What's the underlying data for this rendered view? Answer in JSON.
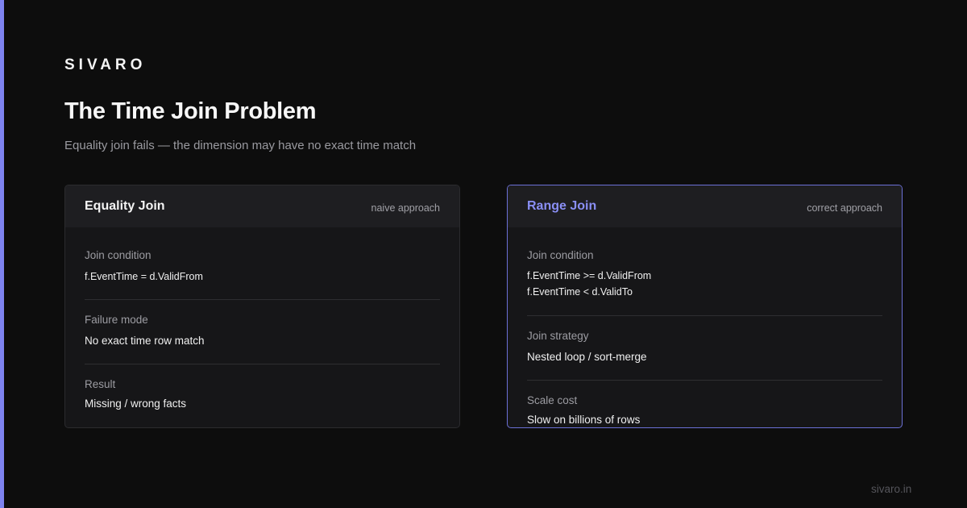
{
  "brand": "SIVARO",
  "title": "The Time Join Problem",
  "subtitle": "Equality join fails — the dimension may have no exact time match",
  "cards": [
    {
      "title": "Equality Join",
      "tag": "naive approach",
      "rows": [
        {
          "label": "Join condition",
          "value_lines": [
            "f.EventTime = d.ValidFrom"
          ]
        },
        {
          "label": "Failure mode",
          "value_lines": [
            "No exact time row match"
          ]
        },
        {
          "label": "Result",
          "value_lines": [
            "Missing / wrong facts"
          ]
        }
      ]
    },
    {
      "title": "Range Join",
      "tag": "correct approach",
      "rows": [
        {
          "label": "Join condition",
          "value_lines": [
            "f.EventTime >= d.ValidFrom",
            "f.EventTime < d.ValidTo"
          ]
        },
        {
          "label": "Join strategy",
          "value_lines": [
            "Nested loop / sort-merge"
          ]
        },
        {
          "label": "Scale cost",
          "value_lines": [
            "Slow on billions of rows"
          ]
        }
      ]
    }
  ],
  "footer": "sivaro.in",
  "colors": {
    "accent": "#7e83f0",
    "background": "#0d0d0d",
    "card": "#161618"
  }
}
